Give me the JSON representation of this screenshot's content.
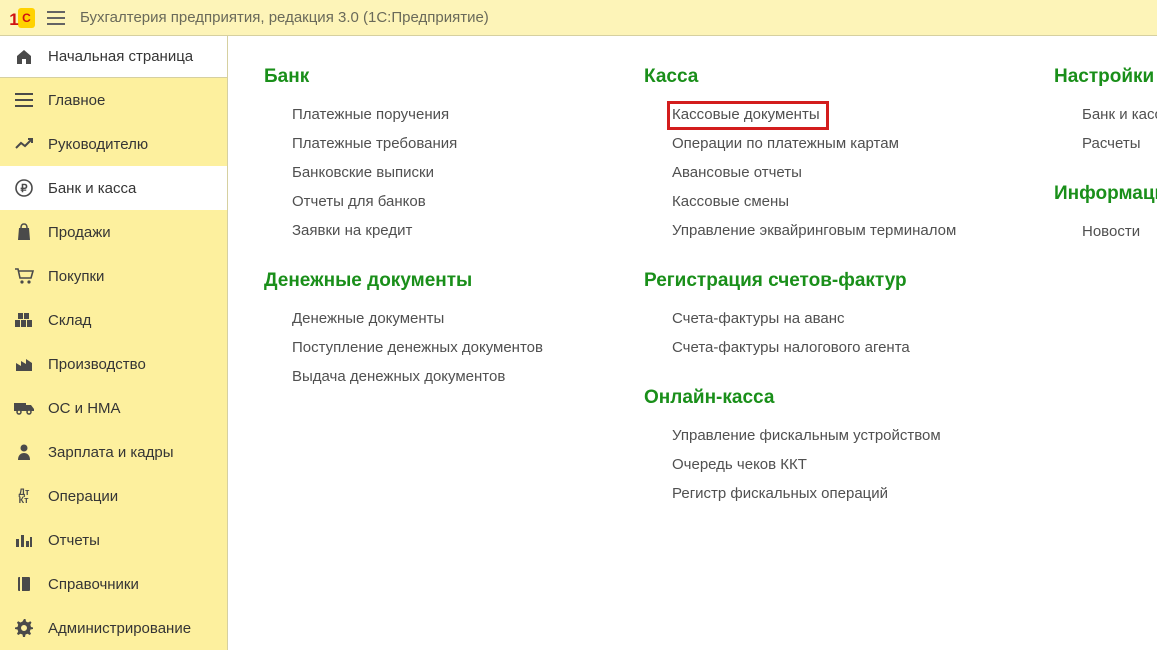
{
  "header": {
    "title": "Бухгалтерия предприятия, редакция 3.0   (1С:Предприятие)"
  },
  "sidebar": {
    "home": "Начальная страница",
    "items": [
      {
        "label": "Главное",
        "icon": "menu-icon"
      },
      {
        "label": "Руководителю",
        "icon": "chart-line-icon"
      },
      {
        "label": "Банк и касса",
        "icon": "ruble-icon",
        "active": true
      },
      {
        "label": "Продажи",
        "icon": "bag-icon"
      },
      {
        "label": "Покупки",
        "icon": "cart-icon"
      },
      {
        "label": "Склад",
        "icon": "warehouse-icon"
      },
      {
        "label": "Производство",
        "icon": "factory-icon"
      },
      {
        "label": "ОС и НМА",
        "icon": "truck-icon"
      },
      {
        "label": "Зарплата и кадры",
        "icon": "person-icon"
      },
      {
        "label": "Операции",
        "icon": "dtkt-icon"
      },
      {
        "label": "Отчеты",
        "icon": "bars-icon"
      },
      {
        "label": "Справочники",
        "icon": "book-icon"
      },
      {
        "label": "Администрирование",
        "icon": "gear-icon"
      }
    ]
  },
  "main": {
    "col1": [
      {
        "title": "Банк",
        "links": [
          "Платежные поручения",
          "Платежные требования",
          "Банковские выписки",
          "Отчеты для банков",
          "Заявки на кредит"
        ]
      },
      {
        "title": "Денежные документы",
        "links": [
          "Денежные документы",
          "Поступление денежных документов",
          "Выдача денежных документов"
        ]
      }
    ],
    "col2": [
      {
        "title": "Касса",
        "links": [
          "Кассовые документы",
          "Операции по платежным картам",
          "Авансовые отчеты",
          "Кассовые смены",
          "Управление эквайринговым терминалом"
        ],
        "highlight_index": 0
      },
      {
        "title": "Регистрация счетов-фактур",
        "links": [
          "Счета-фактуры на аванс",
          "Счета-фактуры налогового агента"
        ]
      },
      {
        "title": "Онлайн-касса",
        "links": [
          "Управление фискальным устройством",
          "Очередь чеков ККТ",
          "Регистр фискальных операций"
        ]
      }
    ],
    "col3": [
      {
        "title": "Настройки",
        "links": [
          "Банк и касса",
          "Расчеты"
        ]
      },
      {
        "title": "Информация",
        "links": [
          "Новости"
        ]
      }
    ]
  }
}
